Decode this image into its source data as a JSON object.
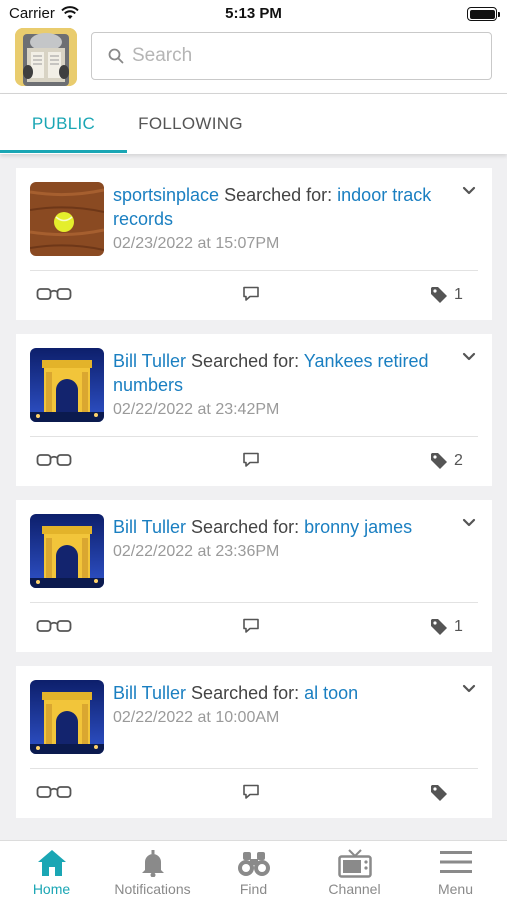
{
  "status_bar": {
    "carrier": "Carrier",
    "time": "5:13 PM"
  },
  "search": {
    "placeholder": "Search",
    "value": ""
  },
  "tabs": [
    {
      "label": "PUBLIC",
      "active": true
    },
    {
      "label": "FOLLOWING",
      "active": false
    }
  ],
  "feed": [
    {
      "user": "sportsinplace",
      "verb": "Searched for:",
      "query": "indoor track records",
      "date": "02/23/2022 at 15:07PM",
      "tag_count": "1",
      "avatar": "tennis-ball-on-wood"
    },
    {
      "user": "Bill Tuller",
      "verb": "Searched for:",
      "query": "Yankees retired numbers",
      "date": "02/22/2022 at 23:42PM",
      "tag_count": "2",
      "avatar": "arc-de-triomphe"
    },
    {
      "user": "Bill Tuller",
      "verb": "Searched for:",
      "query": "bronny james",
      "date": "02/22/2022 at 23:36PM",
      "tag_count": "1",
      "avatar": "arc-de-triomphe"
    },
    {
      "user": "Bill Tuller",
      "verb": "Searched for:",
      "query": "al toon",
      "date": "02/22/2022 at 10:00AM",
      "tag_count": "",
      "avatar": "arc-de-triomphe"
    }
  ],
  "bottom_nav": [
    {
      "label": "Home",
      "icon": "home-icon",
      "active": true
    },
    {
      "label": "Notifications",
      "icon": "bell-icon",
      "active": false
    },
    {
      "label": "Find",
      "icon": "binoculars-icon",
      "active": false
    },
    {
      "label": "Channel",
      "icon": "tv-icon",
      "active": false
    },
    {
      "label": "Menu",
      "icon": "hamburger-icon",
      "active": false
    }
  ],
  "colors": {
    "accent": "#1aa6b4",
    "link": "#1a7fc1",
    "muted": "#9a9a9a"
  }
}
